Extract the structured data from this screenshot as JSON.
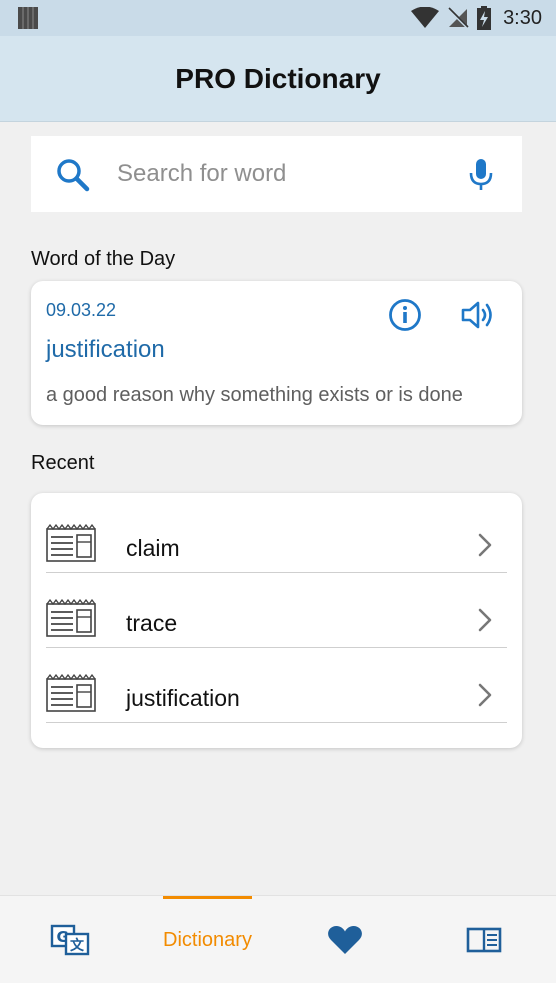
{
  "status_bar": {
    "time": "3:30"
  },
  "app_bar": {
    "title": "PRO Dictionary"
  },
  "search": {
    "placeholder": "Search for word",
    "value": ""
  },
  "word_of_the_day": {
    "section_label": "Word of the Day",
    "date": "09.03.22",
    "word": "justification",
    "definition": "a good reason why something exists or is done"
  },
  "recent": {
    "section_label": "Recent",
    "items": [
      {
        "label": "claim"
      },
      {
        "label": "trace"
      },
      {
        "label": "justification"
      }
    ]
  },
  "bottom_nav": {
    "dictionary_label": "Dictionary"
  },
  "colors": {
    "accent_blue": "#1f6aa8",
    "active_orange": "#f28b00",
    "appbar": "#d5e5ef"
  }
}
